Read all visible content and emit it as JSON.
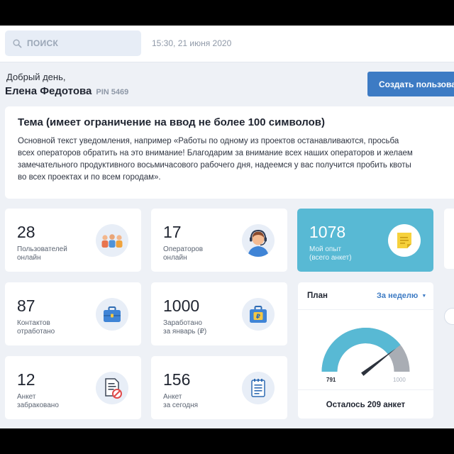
{
  "search": {
    "placeholder": "ПОИСК"
  },
  "header": {
    "datetime": "15:30, 21 июня 2020"
  },
  "user": {
    "greeting": "Добрый день,",
    "name": "Елена Федотова",
    "pin": "PIN 5469"
  },
  "actions": {
    "create_label": "Создать пользова"
  },
  "notice": {
    "title": "Тема (имеет ограничение на ввод не более 100 символов)",
    "lines": [
      "Основной текст уведомления, например «Работы по одному из проектов останавливаются, просьба",
      "всех операторов обратить на это внимание! Благодарим за внимание всех наших операторов и желаем",
      "замечательного продуктивного восьмичасового рабочего дня, надеемся у вас получится пробить квоты",
      "во всех проектах и по всем городам»."
    ]
  },
  "stats": [
    {
      "value": "28",
      "label1": "Пользователей",
      "label2": "онлайн",
      "icon": "users-group-icon"
    },
    {
      "value": "17",
      "label1": "Операторов",
      "label2": "онлайн",
      "icon": "operator-headset-icon"
    },
    {
      "value": "1078",
      "label1": "Мой опыт",
      "label2": "(всего анкет)",
      "icon": "sticky-note-icon"
    },
    {
      "value": "87",
      "label1": "Контактов",
      "label2": "отработано",
      "icon": "briefcase-icon"
    },
    {
      "value": "1000",
      "label1": "Заработано",
      "label2": "за январь (₽)",
      "icon": "ruble-briefcase-icon"
    },
    {
      "value": "12",
      "label1": "Анкет",
      "label2": "забраковано",
      "icon": "rejected-document-icon"
    },
    {
      "value": "156",
      "label1": "Анкет",
      "label2": "за сегодня",
      "icon": "notepad-icon"
    }
  ],
  "plan": {
    "title": "План",
    "period": "За неделю",
    "gauge_min": "791",
    "gauge_max": "1000",
    "gauge_fraction": 0.791,
    "remaining": "Осталось 209 анкет"
  },
  "colors": {
    "accent": "#3d7bc4",
    "highlight_card": "#58b9d4",
    "gauge_fill": "#58b9d4",
    "gauge_rest": "#a9adb4"
  }
}
